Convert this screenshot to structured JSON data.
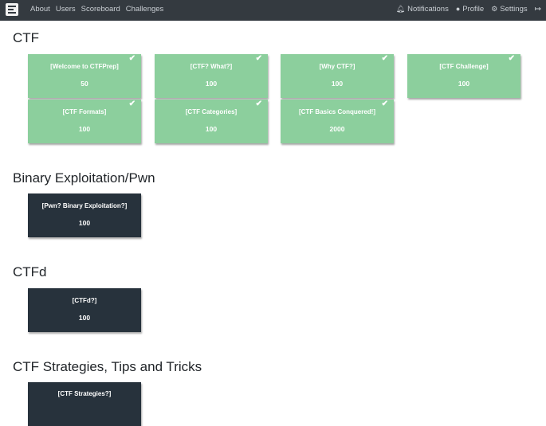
{
  "nav": {
    "links": [
      "About",
      "Users",
      "Scoreboard",
      "Challenges"
    ],
    "right": [
      {
        "label": "Notifications",
        "icon": "bell-icon"
      },
      {
        "label": "Profile",
        "icon": "user-circle-icon"
      },
      {
        "label": "Settings",
        "icon": "gears-icon"
      }
    ],
    "logout_icon": "sign-out-icon"
  },
  "sections": [
    {
      "title": "CTF",
      "challenges": [
        {
          "name": "[Welcome to CTFPrep]",
          "value": "50",
          "solved": true
        },
        {
          "name": "[CTF? What?]",
          "value": "100",
          "solved": true
        },
        {
          "name": "[Why CTF?]",
          "value": "100",
          "solved": true
        },
        {
          "name": "[CTF Challenge]",
          "value": "100",
          "solved": true
        },
        {
          "name": "[CTF Formats]",
          "value": "100",
          "solved": true
        },
        {
          "name": "[CTF Categories]",
          "value": "100",
          "solved": true
        },
        {
          "name": "[CTF Basics Conquered!]",
          "value": "2000",
          "solved": true
        }
      ]
    },
    {
      "title": "Binary Exploitation/Pwn",
      "challenges": [
        {
          "name": "[Pwn? Binary Exploitation?]",
          "value": "100",
          "solved": false
        }
      ]
    },
    {
      "title": "CTFd",
      "challenges": [
        {
          "name": "[CTFd?]",
          "value": "100",
          "solved": false
        }
      ]
    },
    {
      "title": "CTF Strategies, Tips and Tricks",
      "challenges": [
        {
          "name": "[CTF Strategies?]",
          "value": "",
          "solved": false
        }
      ]
    }
  ],
  "colors": {
    "navbar": "#343a40",
    "solved_tile": "#8ccf9d",
    "unsolved_tile": "#27323c"
  }
}
